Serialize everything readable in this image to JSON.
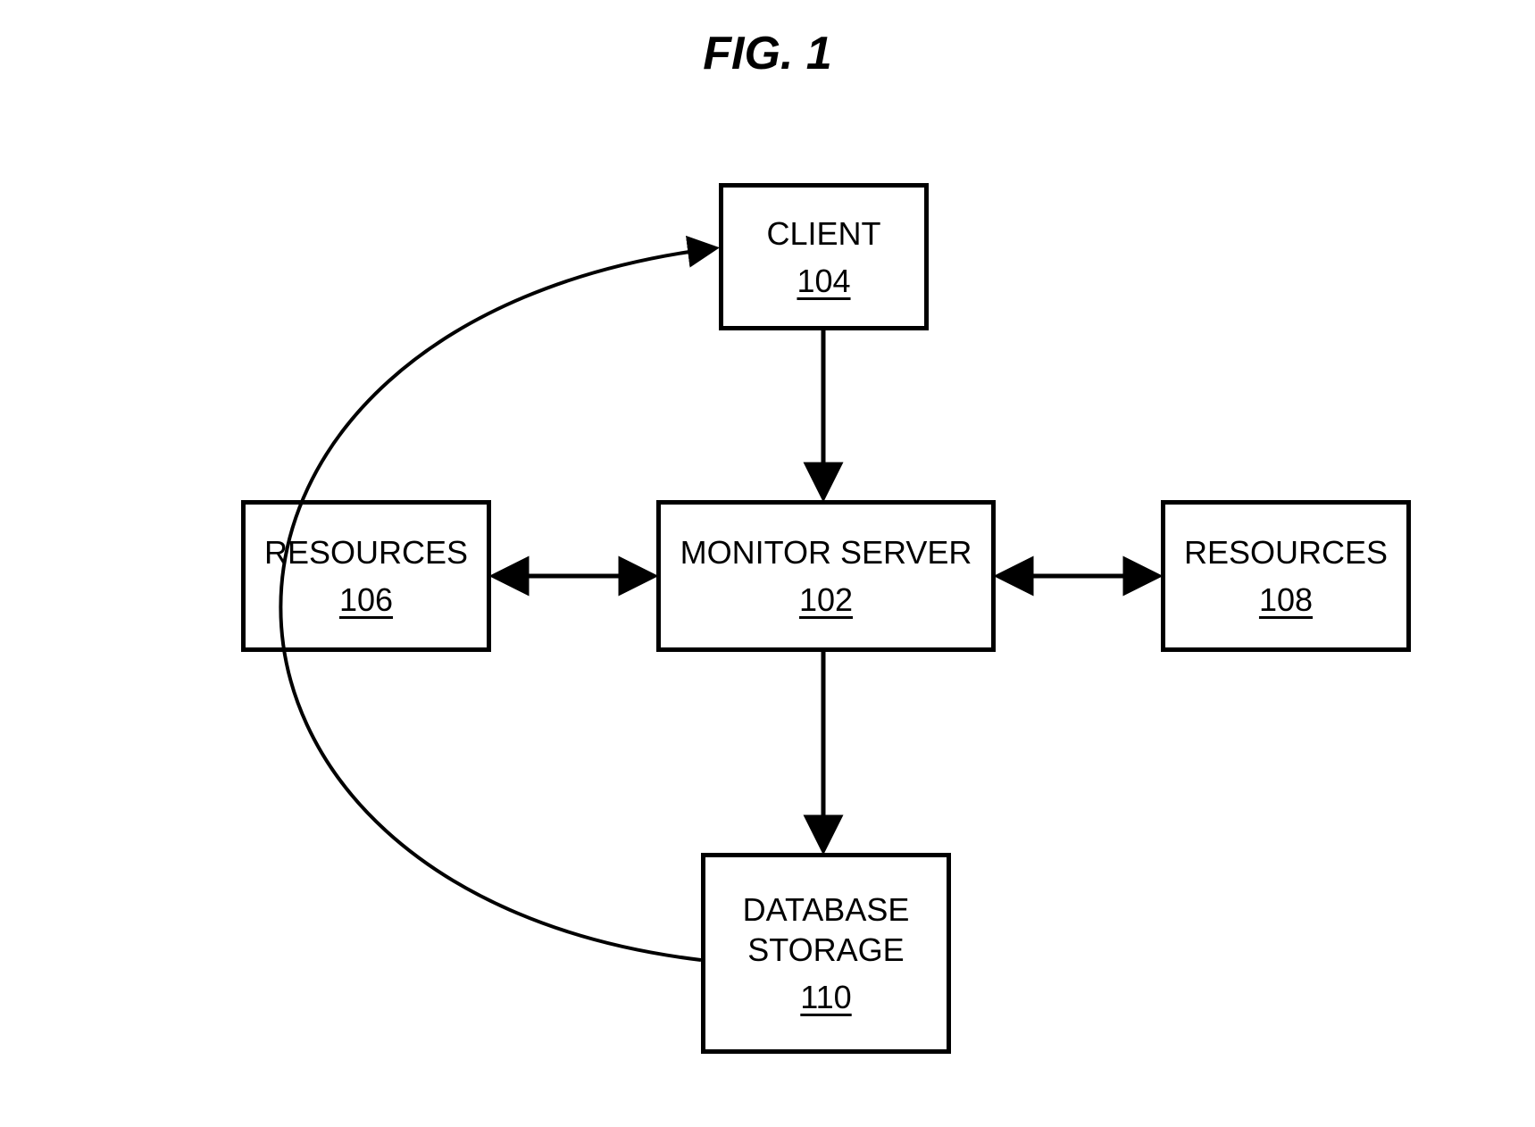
{
  "title": "FIG. 1",
  "nodes": {
    "client": {
      "label": "CLIENT",
      "ref": "104"
    },
    "monitor_server": {
      "label": "MONITOR SERVER",
      "ref": "102"
    },
    "resources_left": {
      "label": "RESOURCES",
      "ref": "106"
    },
    "resources_right": {
      "label": "RESOURCES",
      "ref": "108"
    },
    "database_storage": {
      "label": "DATABASE\nSTORAGE",
      "ref": "110"
    }
  },
  "edges": [
    {
      "from": "client",
      "to": "monitor_server",
      "type": "one-way"
    },
    {
      "from": "monitor_server",
      "to": "resources_left",
      "type": "two-way"
    },
    {
      "from": "monitor_server",
      "to": "resources_right",
      "type": "two-way"
    },
    {
      "from": "monitor_server",
      "to": "database_storage",
      "type": "one-way"
    },
    {
      "from": "database_storage",
      "to": "client",
      "type": "one-way-curved"
    }
  ]
}
